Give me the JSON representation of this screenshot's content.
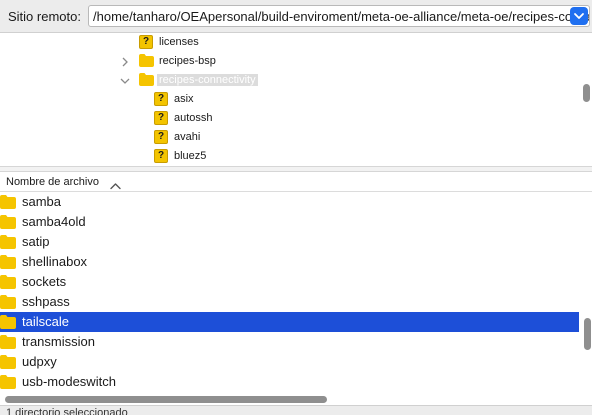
{
  "path_bar": {
    "label": "Sitio remoto:",
    "value": "/home/tanharo/OEApersonal/build-enviroment/meta-oe-alliance/meta-oe/recipes-connectivity"
  },
  "tree": {
    "items": [
      {
        "label": "licenses",
        "icon": "unknown-question-icon",
        "expanded": null,
        "selected": false
      },
      {
        "label": "recipes-bsp",
        "icon": "folder-icon",
        "expanded": false,
        "selected": false
      },
      {
        "label": "recipes-connectivity",
        "icon": "folder-icon",
        "expanded": true,
        "selected": true
      },
      {
        "label": "asix",
        "icon": "unknown-question-icon",
        "expanded": null,
        "selected": false
      },
      {
        "label": "autossh",
        "icon": "unknown-question-icon",
        "expanded": null,
        "selected": false
      },
      {
        "label": "avahi",
        "icon": "unknown-question-icon",
        "expanded": null,
        "selected": false
      },
      {
        "label": "bluez5",
        "icon": "unknown-question-icon",
        "expanded": null,
        "selected": false
      }
    ]
  },
  "file_list": {
    "column_header": "Nombre de archivo",
    "sort": "ascending",
    "items": [
      {
        "name": "samba",
        "selected": false
      },
      {
        "name": "samba4old",
        "selected": false
      },
      {
        "name": "satip",
        "selected": false
      },
      {
        "name": "shellinabox",
        "selected": false
      },
      {
        "name": "sockets",
        "selected": false
      },
      {
        "name": "sshpass",
        "selected": false
      },
      {
        "name": "tailscale",
        "selected": true
      },
      {
        "name": "transmission",
        "selected": false
      },
      {
        "name": "udpxy",
        "selected": false
      },
      {
        "name": "usb-modeswitch",
        "selected": false
      }
    ]
  },
  "status_bar": {
    "text": "1 directorio seleccionado"
  },
  "colors": {
    "selection": "#1d4fd8",
    "folder": "#f5c400",
    "accent": "#1f6ff0"
  }
}
